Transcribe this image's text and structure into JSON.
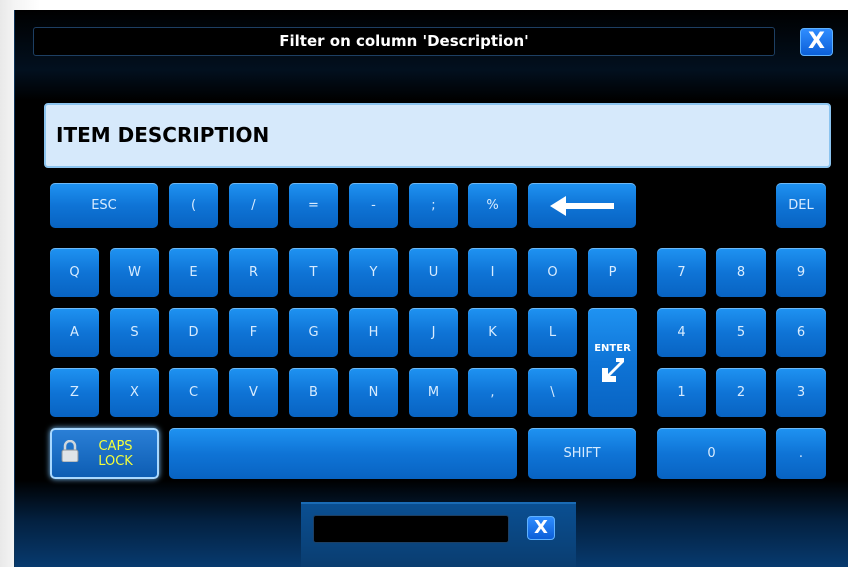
{
  "dialog": {
    "title": "Filter on column 'Description'",
    "close_label": "X",
    "input_value": "ITEM DESCRIPTION"
  },
  "keys": {
    "esc": "ESC",
    "lparen": "(",
    "slash": "/",
    "equals": "=",
    "minus": "-",
    "semicolon": ";",
    "percent": "%",
    "del": "DEL",
    "q": "Q",
    "w": "W",
    "e": "E",
    "r": "R",
    "t": "T",
    "y": "Y",
    "u": "U",
    "i": "I",
    "o": "O",
    "p": "P",
    "a": "A",
    "s": "S",
    "d": "D",
    "f": "F",
    "g": "G",
    "h": "H",
    "j": "J",
    "k": "K",
    "l": "L",
    "z": "Z",
    "x": "X",
    "c": "C",
    "v": "V",
    "b": "B",
    "n": "N",
    "m": "M",
    "comma": ",",
    "backslash": "\\",
    "enter": "ENTER",
    "caps_line1": "CAPS",
    "caps_line2": "LOCK",
    "shift": "SHIFT",
    "n7": "7",
    "n8": "8",
    "n9": "9",
    "n4": "4",
    "n5": "5",
    "n6": "6",
    "n1": "1",
    "n2": "2",
    "n3": "3",
    "n0": "0",
    "dot": "."
  },
  "bottom_panel": {
    "close_label": "X"
  },
  "icons": [
    "backspace-arrow-icon",
    "enter-arrow-icon",
    "lock-icon",
    "close-icon"
  ]
}
